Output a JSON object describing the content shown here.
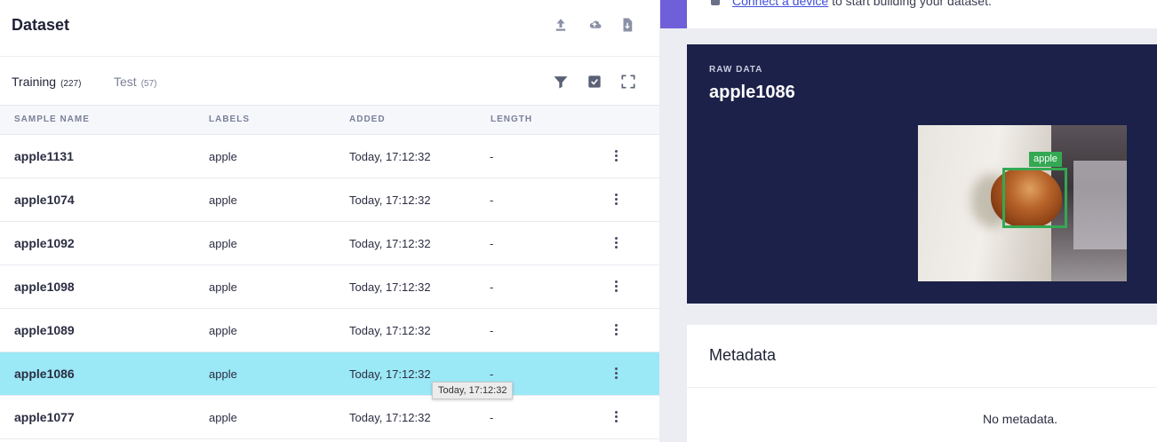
{
  "dataset": {
    "title": "Dataset",
    "tabs": [
      {
        "label": "Training",
        "count": "(227)"
      },
      {
        "label": "Test",
        "count": "(57)"
      }
    ],
    "columns": [
      "SAMPLE NAME",
      "LABELS",
      "ADDED",
      "LENGTH"
    ],
    "rows": [
      {
        "name": "apple1131",
        "label": "apple",
        "added": "Today, 17:12:32",
        "length": "-"
      },
      {
        "name": "apple1074",
        "label": "apple",
        "added": "Today, 17:12:32",
        "length": "-"
      },
      {
        "name": "apple1092",
        "label": "apple",
        "added": "Today, 17:12:32",
        "length": "-"
      },
      {
        "name": "apple1098",
        "label": "apple",
        "added": "Today, 17:12:32",
        "length": "-"
      },
      {
        "name": "apple1089",
        "label": "apple",
        "added": "Today, 17:12:32",
        "length": "-"
      },
      {
        "name": "apple1086",
        "label": "apple",
        "added": "Today, 17:12:32",
        "length": "-"
      },
      {
        "name": "apple1077",
        "label": "apple",
        "added": "Today, 17:12:32",
        "length": "-"
      }
    ],
    "selected_row": 5,
    "tooltip": "Today, 17:12:32",
    "header_icons": [
      "upload-icon",
      "cloud-upload-icon",
      "download-file-icon"
    ],
    "tool_icons": [
      "filter-icon",
      "select-checkbox-icon",
      "expand-icon"
    ]
  },
  "top_banner": {
    "link_text": "Connect a device",
    "text": " to start building your dataset."
  },
  "raw_data": {
    "kicker": "RAW DATA",
    "title": "apple1086",
    "bbox_label": "apple"
  },
  "metadata": {
    "title": "Metadata",
    "empty_text": "No metadata."
  },
  "colors": {
    "accent_purple": "#6f5fd9",
    "raw_card_bg": "#1b2148",
    "selected_row": "#9be8f6",
    "bbox_green": "#34a853"
  }
}
